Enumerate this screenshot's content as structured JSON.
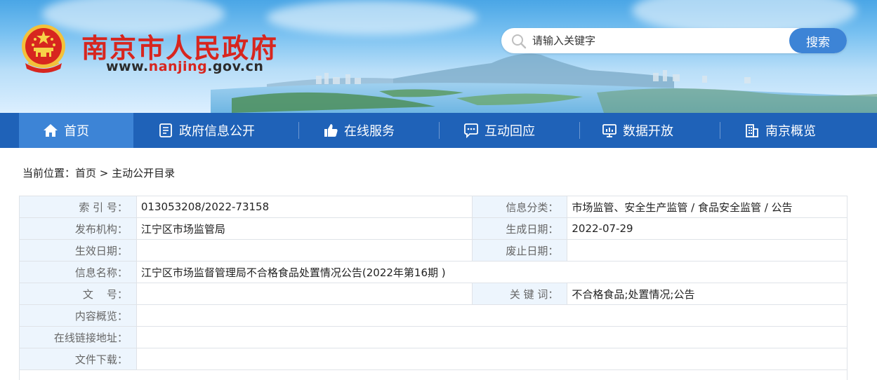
{
  "header": {
    "site_title": "南京市人民政府",
    "url_prefix": "www.",
    "url_highlight": "nanjing",
    "url_suffix": ".gov.cn",
    "emblem_icon": "national-emblem-icon"
  },
  "search": {
    "placeholder": "请输入关键字",
    "button_label": "搜索"
  },
  "nav": {
    "items": [
      {
        "label": "首页",
        "icon": "home-icon"
      },
      {
        "label": "政府信息公开",
        "icon": "document-icon"
      },
      {
        "label": "在线服务",
        "icon": "thumbs-up-icon"
      },
      {
        "label": "互动回应",
        "icon": "chat-icon"
      },
      {
        "label": "数据开放",
        "icon": "monitor-chart-icon"
      },
      {
        "label": "南京概览",
        "icon": "building-icon"
      }
    ]
  },
  "breadcrumb": {
    "prefix": "当前位置：",
    "home": "首页",
    "separator": " > ",
    "current": "主动公开目录"
  },
  "info": {
    "index_label": "索 引 号：",
    "index_value": "013053208/2022-73158",
    "category_label": "信息分类：",
    "category_value": "市场监管、安全生产监管 / 食品安全监管 / 公告",
    "publisher_label": "发布机构：",
    "publisher_value": "江宁区市场监管局",
    "created_label": "生成日期：",
    "created_value": "2022-07-29",
    "effective_label": "生效日期：",
    "effective_value": "",
    "expiry_label": "废止日期：",
    "expiry_value": "",
    "name_label": "信息名称：",
    "name_value": "江宁区市场监督管理局不合格食品处置情况公告(2022年第16期 )",
    "docno_label": "文    号：",
    "docno_value": "",
    "keywords_label": "关 键 词：",
    "keywords_value": "不合格食品;处置情况;公告",
    "summary_label": "内容概览：",
    "summary_value": "",
    "link_label": "在线链接地址：",
    "link_value": "",
    "download_label": "文件下载：",
    "download_value": ""
  },
  "colors": {
    "brand_red": "#d7261f",
    "nav_blue": "#1f62b8",
    "nav_active": "#3d84d6",
    "label_bg": "#edf5fd"
  }
}
